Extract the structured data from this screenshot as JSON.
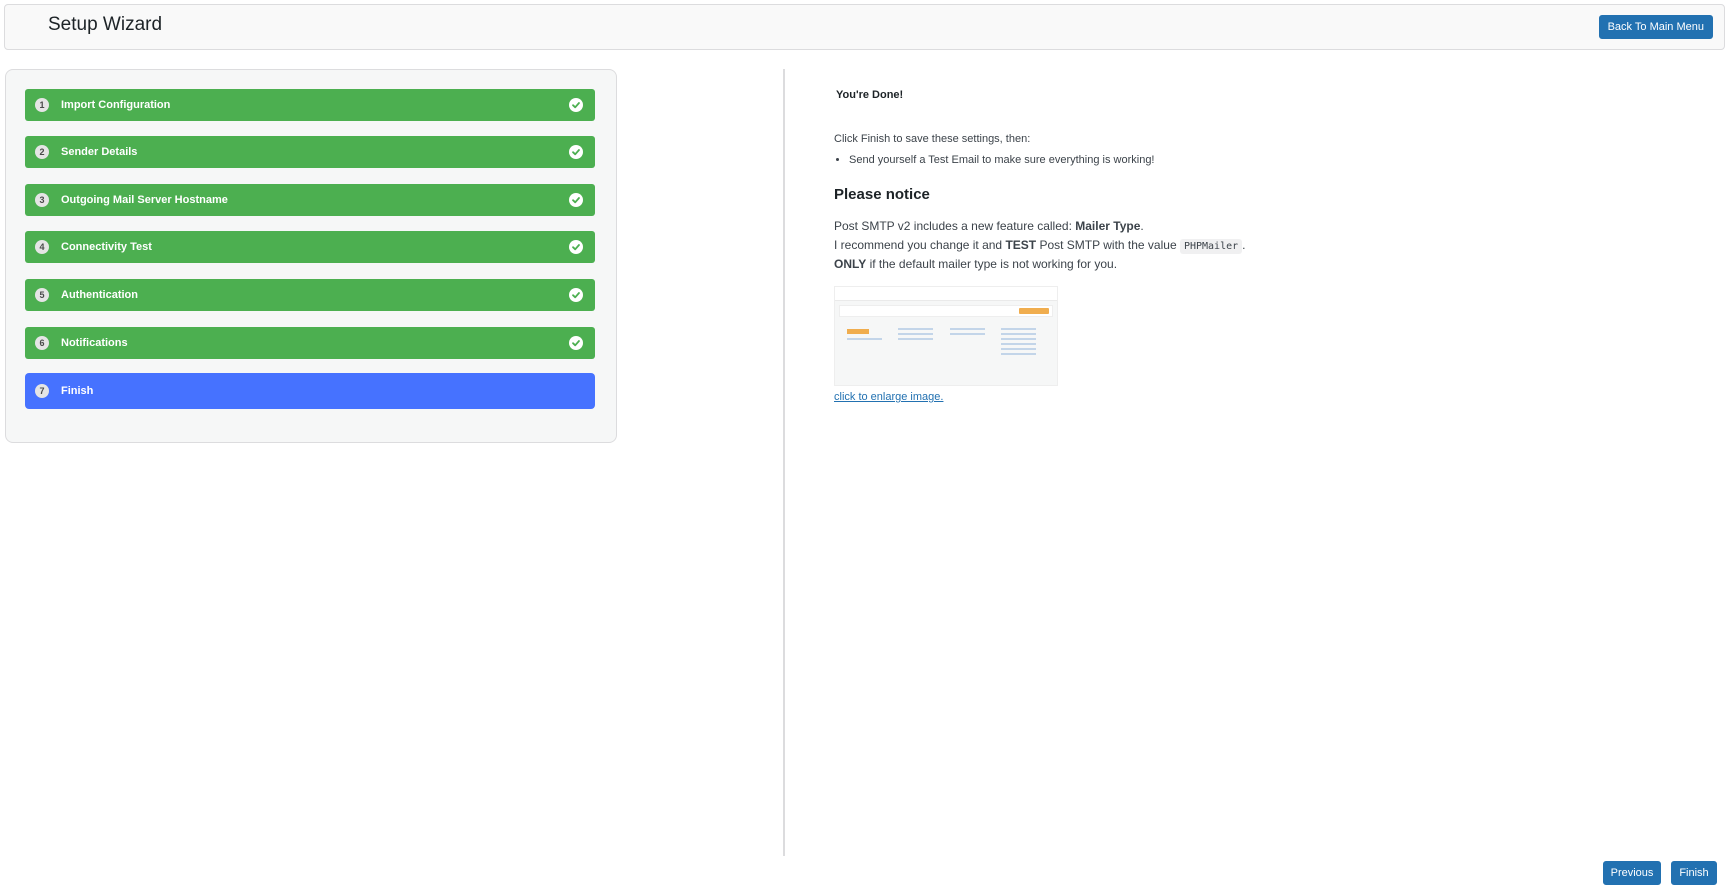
{
  "header": {
    "title": "Setup Wizard",
    "back_button": "Back To Main Menu"
  },
  "steps": [
    {
      "num": "1",
      "label": "Import Configuration",
      "completed": true
    },
    {
      "num": "2",
      "label": "Sender Details",
      "completed": true
    },
    {
      "num": "3",
      "label": "Outgoing Mail Server Hostname",
      "completed": true
    },
    {
      "num": "4",
      "label": "Connectivity Test",
      "completed": true
    },
    {
      "num": "5",
      "label": "Authentication",
      "completed": true
    },
    {
      "num": "6",
      "label": "Notifications",
      "completed": true
    },
    {
      "num": "7",
      "label": "Finish",
      "completed": false,
      "active": true
    }
  ],
  "content": {
    "done_heading": "You're Done!",
    "intro": "Click Finish to save these settings, then:",
    "bullets": [
      "Send yourself a Test Email to make sure everything is working!"
    ],
    "notice_heading": "Please notice",
    "line1_prefix": "Post SMTP v2 includes a new feature called: ",
    "line1_bold": "Mailer Type",
    "line1_suffix": ".",
    "line2_prefix": "I recommend you change it and ",
    "line2_bold": "TEST",
    "line2_middle": " Post SMTP with the value ",
    "line2_code": "PHPMailer",
    "line2_suffix": ".",
    "line3_bold": "ONLY",
    "line3_suffix": " if the default mailer type is not working for you.",
    "enlarge_link": "click to enlarge image."
  },
  "footer": {
    "previous": "Previous",
    "finish": "Finish"
  },
  "colors": {
    "step_completed": "#4caf50",
    "step_active": "#4672ff",
    "button": "#2271b1"
  },
  "icons": {
    "completed": "check-circle-icon"
  }
}
